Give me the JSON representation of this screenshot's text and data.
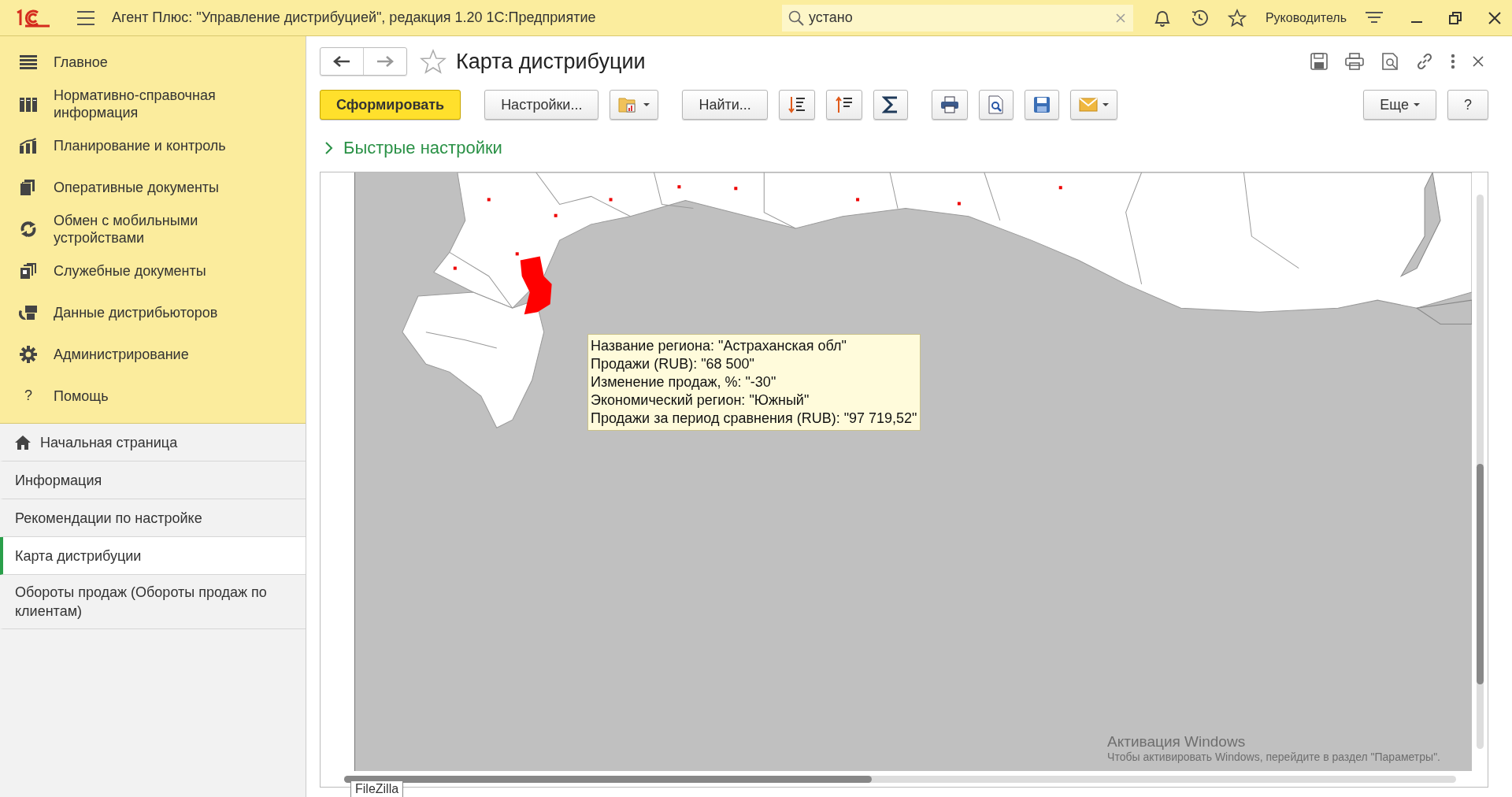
{
  "window": {
    "title": "Агент Плюс: \"Управление дистрибуцией\", редакция 1.20 1С:Предприятие",
    "search": {
      "value": "устано"
    },
    "user": "Руководитель"
  },
  "sections": [
    {
      "label": "Главное"
    },
    {
      "label": "Нормативно-справочная информация"
    },
    {
      "label": "Планирование и контроль"
    },
    {
      "label": "Оперативные документы"
    },
    {
      "label": "Обмен с мобильными устройствами"
    },
    {
      "label": "Служебные документы"
    },
    {
      "label": "Данные дистрибьюторов"
    },
    {
      "label": "Администрирование"
    },
    {
      "label": "Помощь",
      "kind": "text-icon",
      "glyph": "?"
    }
  ],
  "open_pages": [
    {
      "label": "Начальная страница",
      "kind": "home",
      "selected": false
    },
    {
      "label": "Информация",
      "kind": "page",
      "selected": false
    },
    {
      "label": "Рекомендации по настройке",
      "kind": "page",
      "selected": false
    },
    {
      "label": "Карта дистрибуции",
      "kind": "page",
      "selected": true
    },
    {
      "label": "Обороты продаж (Обороты продаж по клиентам)",
      "kind": "page",
      "selected": false
    }
  ],
  "form": {
    "title": "Карта дистрибуции",
    "favorite": false,
    "toolbar": [
      [
        {
          "kind": "primary",
          "label": "Сформировать"
        }
      ],
      [
        {
          "kind": "text",
          "label": "Настройки..."
        },
        {
          "kind": "icon-menu"
        }
      ],
      [
        {
          "kind": "text",
          "label": "Найти..."
        },
        {
          "kind": "icon"
        },
        {
          "kind": "icon"
        },
        {
          "kind": "icon"
        }
      ],
      [
        {
          "kind": "icon"
        },
        {
          "kind": "icon"
        },
        {
          "kind": "icon"
        },
        {
          "kind": "icon-menu"
        }
      ]
    ],
    "toolbar_right": [
      {
        "kind": "text-menu",
        "label": "Еще"
      },
      {
        "kind": "text",
        "label": "?"
      }
    ],
    "quick_settings": {
      "label": "Быстрые настройки",
      "expanded": false
    },
    "map": {
      "tooltip": [
        "Название региона: \"Астраханская обл\"",
        "Продажи (RUB): \"68 500\"",
        "Изменение продаж, %: \"-30\"",
        "Экономический регион: \"Южный\"",
        "Продажи за период сравнения (RUB): \"97 719,52\""
      ]
    }
  },
  "os_notice": {
    "title": "Активация Windows",
    "text": "Чтобы активировать Windows, перейдите в раздел \"Параметры\"."
  },
  "taskbar_tooltip": "FileZilla"
}
